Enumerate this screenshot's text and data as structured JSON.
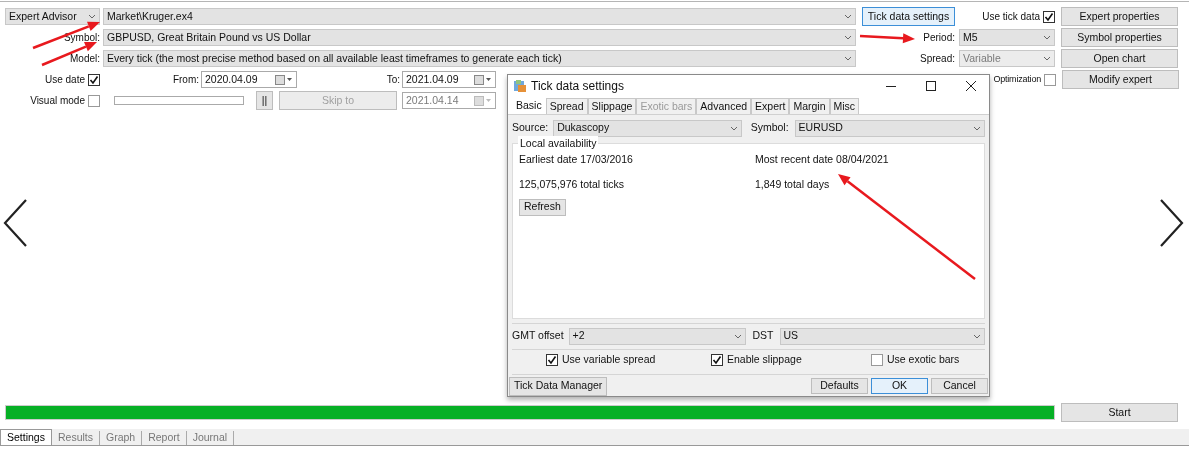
{
  "tester": {
    "program_type": {
      "value": "Expert Advisor"
    },
    "expert_file": {
      "value": "Market\\Kruger.ex4"
    },
    "tick_data_button": {
      "label": "Tick data settings"
    },
    "use_tick_data": {
      "label": "Use tick data",
      "checked": true
    },
    "symbol": {
      "label": "Symbol:",
      "value": "GBPUSD, Great Britain Pound vs US Dollar"
    },
    "period": {
      "label": "Period:",
      "value": "M5",
      "disabled": false
    },
    "model": {
      "label": "Model:",
      "value": "Every tick (the most precise method based on all available least timeframes to generate each tick)"
    },
    "spread": {
      "label": "Spread:",
      "value": "Variable",
      "disabled": true
    },
    "use_date": {
      "label": "Use date",
      "checked": true
    },
    "from": {
      "label": "From:",
      "value": "2020.04.09",
      "disabled": false
    },
    "to": {
      "label": "To:",
      "value": "2021.04.09",
      "disabled": false
    },
    "optimization": {
      "label": "Optimization",
      "checked": false
    },
    "visual_mode": {
      "label": "Visual mode",
      "checked": false
    },
    "speed_slider": {
      "level": 0
    },
    "pause_button": {
      "label": "||"
    },
    "skip_to": {
      "label": "Skip to",
      "disabled": true
    },
    "skip_date": {
      "value": "2021.04.14",
      "disabled": true
    },
    "side_buttons": [
      "Expert properties",
      "Symbol properties",
      "Open chart",
      "Modify expert"
    ],
    "progress": {
      "level": 1
    },
    "start_button": {
      "label": "Start"
    },
    "tabs": [
      {
        "label": "Settings",
        "selected": true
      },
      {
        "label": "Results",
        "selected": false
      },
      {
        "label": "Graph",
        "selected": false
      },
      {
        "label": "Report",
        "selected": false
      },
      {
        "label": "Journal",
        "selected": false
      }
    ]
  },
  "dialog": {
    "title": "Tick data settings",
    "tabs": [
      {
        "label": "Basic",
        "selected": true,
        "disabled": false
      },
      {
        "label": "Spread",
        "selected": false,
        "disabled": false
      },
      {
        "label": "Slippage",
        "selected": false,
        "disabled": false
      },
      {
        "label": "Exotic bars",
        "selected": false,
        "disabled": true
      },
      {
        "label": "Advanced",
        "selected": false,
        "disabled": false
      },
      {
        "label": "Expert",
        "selected": false,
        "disabled": false
      },
      {
        "label": "Margin",
        "selected": false,
        "disabled": false
      },
      {
        "label": "Misc",
        "selected": false,
        "disabled": false
      }
    ],
    "source": {
      "label": "Source:",
      "value": "Dukascopy"
    },
    "symbol": {
      "label": "Symbol:",
      "value": "EURUSD"
    },
    "availability": {
      "title": "Local availability",
      "items": [
        "Earliest date 17/03/2016",
        "Most recent date 08/04/2021",
        "125,075,976 total ticks",
        "1,849 total days"
      ],
      "refresh_button": "Refresh"
    },
    "gmt_offset": {
      "label": "GMT offset",
      "value": "+2"
    },
    "dst": {
      "label": "DST",
      "value": "US"
    },
    "options": [
      {
        "label": "Use variable spread",
        "checked": true
      },
      {
        "label": "Enable slippage",
        "checked": true
      },
      {
        "label": "Use exotic bars",
        "checked": false
      }
    ],
    "manager_button": "Tick Data Manager",
    "buttons": [
      {
        "label": "Defaults",
        "selected": false
      },
      {
        "label": "OK",
        "selected": true
      },
      {
        "label": "Cancel",
        "selected": false
      }
    ]
  }
}
